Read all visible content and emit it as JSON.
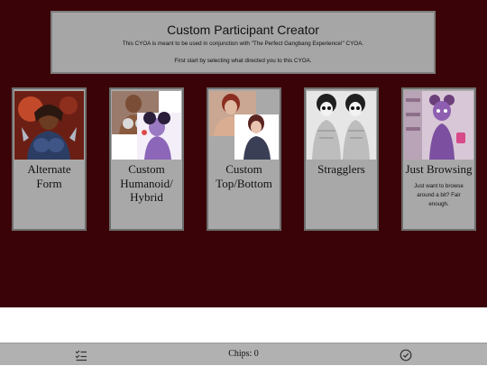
{
  "header": {
    "title": "Custom Participant Creator",
    "line1": "This CYOA is meant to be used in conjunction with \"The Perfect Gangbang Experience!\" CYOA.",
    "line2": "First start by selecting what directed you to this CYOA."
  },
  "cards": [
    {
      "label": "Alternate Form",
      "description": "",
      "image": "figure-art"
    },
    {
      "label": "Custom Humanoid/ Hybrid",
      "description": "",
      "image": "figure-art"
    },
    {
      "label": "Custom Top/Bottom",
      "description": "",
      "image": "figure-art"
    },
    {
      "label": "Stragglers",
      "description": "",
      "image": "figure-art-grayscale"
    },
    {
      "label": "Just Browsing",
      "description": "Just want to browse around a bit? Fair enough.",
      "image": "figure-art"
    }
  ],
  "footer": {
    "chips_text": "Chips: 0",
    "left_icon": "checklist-icon",
    "right_icon": "check-circle-icon"
  },
  "colors": {
    "background": "#3a0307",
    "panel": "#a8a8a8",
    "footer": "#b1b1b1"
  }
}
